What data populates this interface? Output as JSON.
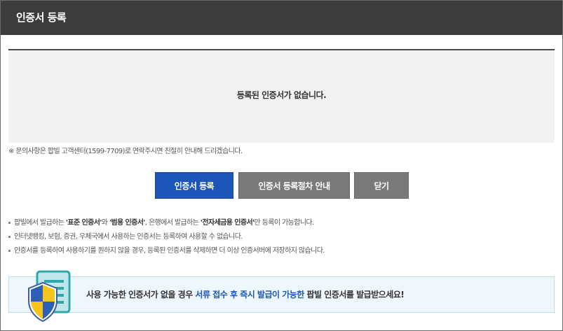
{
  "titlebar": {
    "title": "인증서 등록"
  },
  "cert_list": {
    "empty_message": "등록된 인증서가 없습니다."
  },
  "inquiry_note": "※ 문의사항은 팝빌 고객센터(1599-7709)로 연락주시면 친절히 안내해 드리겠습니다.",
  "buttons": {
    "register": "인증서 등록",
    "guide": "인증서 등록절차 안내",
    "close": "닫기"
  },
  "notes": [
    {
      "parts": [
        {
          "text": "팝빌에서 발급하는 ",
          "bold": false
        },
        {
          "text": "'표준 인증서'",
          "bold": true
        },
        {
          "text": "와 ",
          "bold": false
        },
        {
          "text": "'범용 인증서'",
          "bold": true
        },
        {
          "text": ", 은행에서 발급하는 ",
          "bold": false
        },
        {
          "text": "'전자세금용 인증서'",
          "bold": true
        },
        {
          "text": "만 등록이 가능합니다.",
          "bold": false
        }
      ]
    },
    {
      "parts": [
        {
          "text": "인터넷뱅킹, 보험, 증권, 우체국에서 사용하는 인증서는 등록하여 사용할 수 없습니다.",
          "bold": false
        }
      ]
    },
    {
      "parts": [
        {
          "text": "인증서를 등록하여 사용하기를 원하지 않을 경우, 등록된 인증서를 삭제하면 더 이상 인증서버에 저장하지 않습니다.",
          "bold": false
        }
      ]
    }
  ],
  "banner": {
    "text_before": "사용 가능한 인증서가 없을 경우 ",
    "text_highlight": "서류 접수 후 즉시 발급이 가능한",
    "text_after": " 팝빌 인증서를 발급받으세요!",
    "illustration": "shield-document-icon"
  },
  "colors": {
    "titlebar_bg": "#3c3c3c",
    "primary_button": "#1b56b8",
    "secondary_button": "#7a7a7a",
    "banner_bg": "#eef7fd",
    "highlight_text": "#1b56b8"
  }
}
